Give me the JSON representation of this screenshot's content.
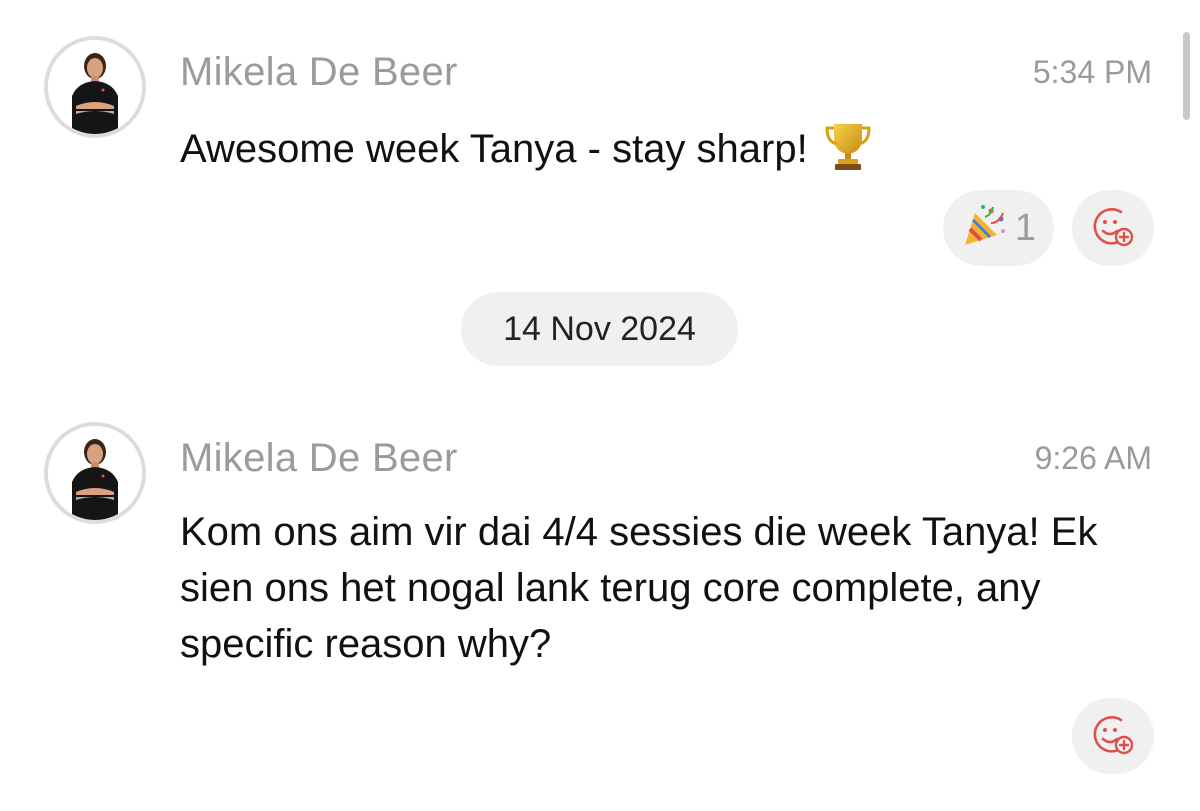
{
  "messages": [
    {
      "sender": "Mikela De Beer",
      "time": "5:34 PM",
      "text": "Awesome week Tanya - stay sharp!",
      "emoji_icon": "trophy-icon",
      "reactions": [
        {
          "icon": "party-popper-icon",
          "count": "1"
        }
      ],
      "add_reaction_icon": "add-reaction-icon"
    },
    {
      "sender": "Mikela De Beer",
      "time": "9:26 AM",
      "text": "Kom ons aim vir dai 4/4 sessies die week Tanya! Ek sien ons het nogal lank terug core complete, any specific reason why?",
      "reactions": [],
      "add_reaction_icon": "add-reaction-icon"
    }
  ],
  "date_separator": "14 Nov 2024",
  "colors": {
    "secondary_text": "#9b9b9b",
    "pill_background": "#f0f0f0",
    "accent": "#e0504a"
  }
}
